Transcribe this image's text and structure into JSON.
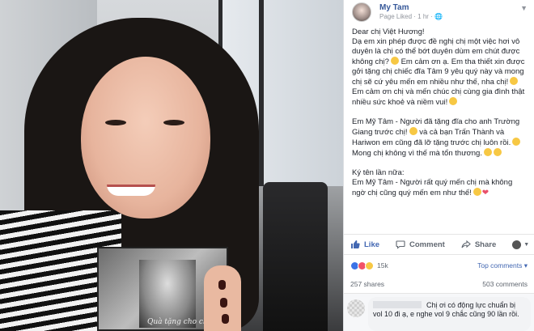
{
  "post": {
    "author": "My Tam",
    "meta": "Page Liked · 1 hr · ",
    "paragraphs": [
      "Dear chị Việt Hương!",
      "Dạ em xin phép được đề nghị chị một việc hơi vô duyên là chị có thể bớt duyên dùm em chút được không chị?",
      "Em cảm ơn ạ. Em tha thiết xin được gởi tặng chị chiếc đĩa Tâm 9 yêu quý này và mong chị sẽ cứ yêu mến em nhiều như thế, nha chị!",
      "Em cảm ơn chị và mến chúc chị cùng gia đình thật nhiều sức khoẻ và niềm vui!",
      "Em Mỹ Tâm - Người đã tặng đĩa cho anh Trường Giang trước chị!",
      "và cả bạn Trấn Thành và Hariwon em cũng đã lỡ tặng trước chị luôn rồi.",
      "Mong chị không vì thế mà tổn thương.",
      "Ký tên lần nữa:",
      "Em Mỹ Tâm - Người rất quý mến chị mà không ngờ chị cũng quý mến em như thế!"
    ],
    "cd_signature": "Quà tặng cho chị"
  },
  "actions": {
    "like": "Like",
    "comment": "Comment",
    "share": "Share"
  },
  "reactions": {
    "count": "15k",
    "top_comments": "Top comments ▾"
  },
  "stats": {
    "shares": "257 shares",
    "comments": "503 comments"
  },
  "comment": {
    "text": "Chị ơi có động lực chuẩn bị vol 10 đi ạ, e nghe vol 9 chắc cũng 90 lần rồi."
  },
  "colors": {
    "link": "#365899",
    "like_blue": "#4267b2",
    "meta_gray": "#90949c"
  }
}
